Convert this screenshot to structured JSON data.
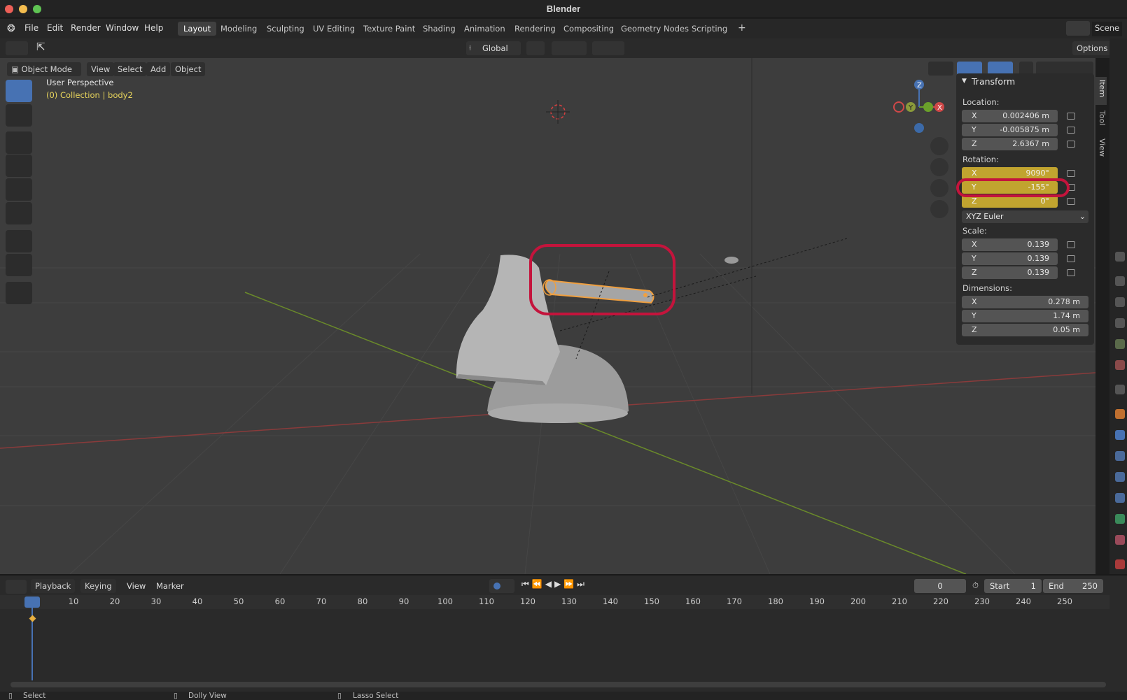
{
  "window": {
    "title": "Blender"
  },
  "menubar": {
    "menus": [
      "File",
      "Edit",
      "Render",
      "Window",
      "Help"
    ],
    "workspaces": [
      "Layout",
      "Modeling",
      "Sculpting",
      "UV Editing",
      "Texture Paint",
      "Shading",
      "Animation",
      "Rendering",
      "Compositing",
      "Geometry Nodes",
      "Scripting"
    ],
    "add_tab": "+",
    "scene": "Scene"
  },
  "tool_header": {
    "orientation": "Global",
    "options": "Options"
  },
  "viewport_header": {
    "mode": "Object Mode",
    "menus": [
      "View",
      "Select",
      "Add",
      "Object"
    ]
  },
  "viewport": {
    "perspective": "User Perspective",
    "collection": "(0) Collection | body2"
  },
  "gizmo": {
    "x": "X",
    "y": "Y",
    "z": "Z"
  },
  "npanel": {
    "tabs": [
      "Item",
      "Tool",
      "View"
    ],
    "section": "Transform",
    "location_label": "Location:",
    "location": [
      {
        "axis": "X",
        "value": "0.002406 m"
      },
      {
        "axis": "Y",
        "value": "-0.005875 m"
      },
      {
        "axis": "Z",
        "value": "2.6367 m"
      }
    ],
    "rotation_label": "Rotation:",
    "rotation": [
      {
        "axis": "X",
        "value": "9090°"
      },
      {
        "axis": "Y",
        "value": "-155°"
      },
      {
        "axis": "Z",
        "value": "0°"
      }
    ],
    "rotation_mode": "XYZ Euler",
    "scale_label": "Scale:",
    "scale": [
      {
        "axis": "X",
        "value": "0.139"
      },
      {
        "axis": "Y",
        "value": "0.139"
      },
      {
        "axis": "Z",
        "value": "0.139"
      }
    ],
    "dimensions_label": "Dimensions:",
    "dimensions": [
      {
        "axis": "X",
        "value": "0.278 m"
      },
      {
        "axis": "Y",
        "value": "1.74 m"
      },
      {
        "axis": "Z",
        "value": "0.05 m"
      }
    ]
  },
  "timeline": {
    "menus": [
      "Playback",
      "Keying",
      "View",
      "Marker"
    ],
    "current_frame": "0",
    "start_label": "Start",
    "start": "1",
    "end_label": "End",
    "end": "250",
    "ruler": [
      "0",
      "10",
      "20",
      "30",
      "40",
      "50",
      "60",
      "70",
      "80",
      "90",
      "100",
      "110",
      "120",
      "130",
      "140",
      "150",
      "160",
      "170",
      "180",
      "190",
      "200",
      "210",
      "220",
      "230",
      "240",
      "250"
    ]
  },
  "statusbar": {
    "select": "Select",
    "dolly": "Dolly View",
    "lasso": "Lasso Select"
  },
  "colors": {
    "selection_outline": "#f0a040",
    "highlight_annotation": "#c4143c",
    "animated_field": "#c1a42f",
    "active_blue": "#4772b3"
  }
}
